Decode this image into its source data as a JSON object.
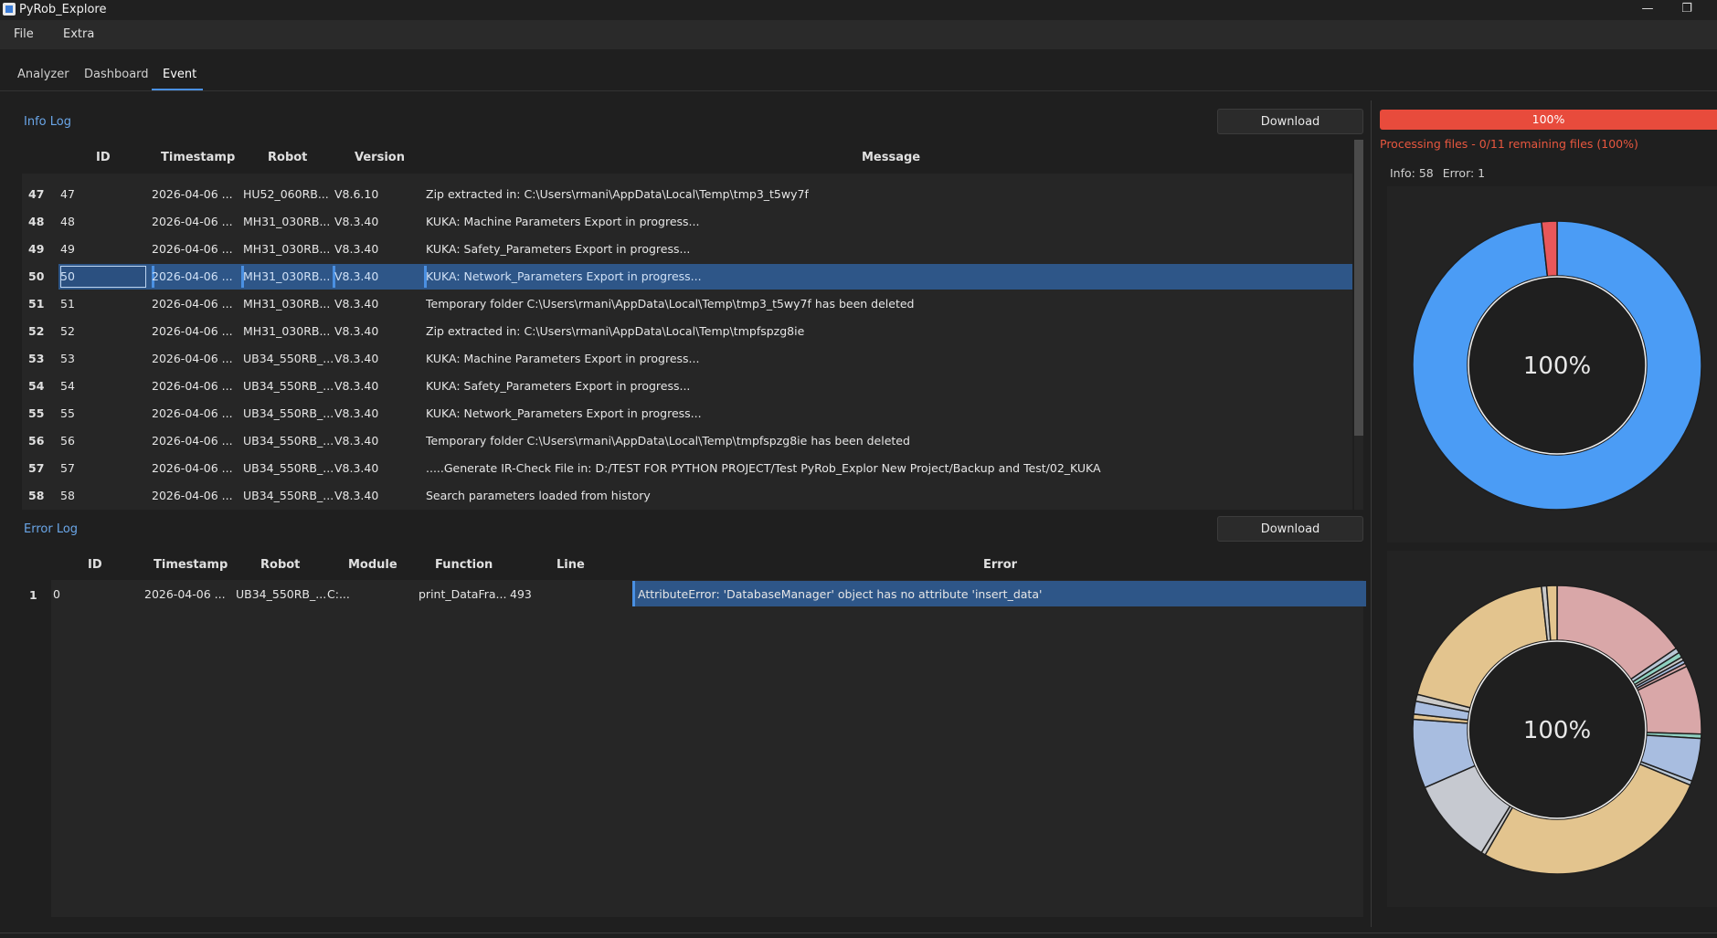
{
  "window": {
    "title": "PyRob_Explore",
    "minimize": "—",
    "restore": "❐"
  },
  "menu": {
    "items": [
      "File",
      "Extra"
    ]
  },
  "tabs": [
    "Analyzer",
    "Dashboard",
    "Event"
  ],
  "info_log": {
    "label": "Info Log",
    "download": "Download",
    "headers": {
      "id": "ID",
      "timestamp": "Timestamp",
      "robot": "Robot",
      "version": "Version",
      "message": "Message"
    },
    "rows": [
      {
        "n": "47",
        "id": "47",
        "ts": "2026-04-06 ...",
        "robot": "HU52_060RB...",
        "ver": "V8.6.10",
        "msg": "Zip extracted in: C:\\Users\\rmani\\AppData\\Local\\Temp\\tmp3_t5wy7f"
      },
      {
        "n": "48",
        "id": "48",
        "ts": "2026-04-06 ...",
        "robot": "MH31_030RB...",
        "ver": "V8.3.40",
        "msg": "KUKA: Machine Parameters Export in progress..."
      },
      {
        "n": "49",
        "id": "49",
        "ts": "2026-04-06 ...",
        "robot": "MH31_030RB...",
        "ver": "V8.3.40",
        "msg": "KUKA: Safety_Parameters Export in progress..."
      },
      {
        "n": "50",
        "id": "50",
        "ts": "2026-04-06 ...",
        "robot": "MH31_030RB...",
        "ver": "V8.3.40",
        "msg": "KUKA: Network_Parameters Export in progress..."
      },
      {
        "n": "51",
        "id": "51",
        "ts": "2026-04-06 ...",
        "robot": "MH31_030RB...",
        "ver": "V8.3.40",
        "msg": "Temporary folder C:\\Users\\rmani\\AppData\\Local\\Temp\\tmp3_t5wy7f has been deleted"
      },
      {
        "n": "52",
        "id": "52",
        "ts": "2026-04-06 ...",
        "robot": "MH31_030RB...",
        "ver": "V8.3.40",
        "msg": "Zip extracted in: C:\\Users\\rmani\\AppData\\Local\\Temp\\tmpfspzg8ie"
      },
      {
        "n": "53",
        "id": "53",
        "ts": "2026-04-06 ...",
        "robot": "UB34_550RB_...",
        "ver": "V8.3.40",
        "msg": "KUKA: Machine Parameters Export in progress..."
      },
      {
        "n": "54",
        "id": "54",
        "ts": "2026-04-06 ...",
        "robot": "UB34_550RB_...",
        "ver": "V8.3.40",
        "msg": "KUKA: Safety_Parameters Export in progress..."
      },
      {
        "n": "55",
        "id": "55",
        "ts": "2026-04-06 ...",
        "robot": "UB34_550RB_...",
        "ver": "V8.3.40",
        "msg": "KUKA: Network_Parameters Export in progress..."
      },
      {
        "n": "56",
        "id": "56",
        "ts": "2026-04-06 ...",
        "robot": "UB34_550RB_...",
        "ver": "V8.3.40",
        "msg": "Temporary folder C:\\Users\\rmani\\AppData\\Local\\Temp\\tmpfspzg8ie has been deleted"
      },
      {
        "n": "57",
        "id": "57",
        "ts": "2026-04-06 ...",
        "robot": "UB34_550RB_...",
        "ver": "V8.3.40",
        "msg": ".....Generate IR-Check File in: D:/TEST FOR PYTHON PROJECT/Test PyRob_Explor New Project/Backup  and Test/02_KUKA"
      },
      {
        "n": "58",
        "id": "58",
        "ts": "2026-04-06 ...",
        "robot": "UB34_550RB_...",
        "ver": "V8.3.40",
        "msg": "Search parameters loaded from history"
      }
    ]
  },
  "error_log": {
    "label": "Error Log",
    "download": "Download",
    "headers": {
      "id": "ID",
      "timestamp": "Timestamp",
      "robot": "Robot",
      "module": "Module",
      "function": "Function",
      "line": "Line",
      "error": "Error"
    },
    "rows": [
      {
        "n": "1",
        "id": "0",
        "ts": "2026-04-06 ...",
        "robot": "UB34_550RB_...",
        "module": "C:...",
        "function": "print_DataFra...",
        "line": "493",
        "error": "AttributeError: 'DatabaseManager' object has no attribute 'insert_data'"
      }
    ]
  },
  "status": {
    "progress_percent": 100,
    "progress_label": "100%",
    "processing_text": "Processing files - 0/11 remaining files (100%)",
    "info_label": "Info: 58",
    "error_label": "Error: 1",
    "color_error": "#e84b3c"
  },
  "charts": [
    {
      "center_label": "100%",
      "slices": [
        {
          "value": 57,
          "color": "#4b9cf5"
        },
        {
          "value": 1,
          "color": "#e8575a"
        }
      ]
    },
    {
      "center_label": "100%",
      "slices": [
        {
          "value": 16,
          "color": "#d9a7a8"
        },
        {
          "value": 0.6,
          "color": "#b9c7d6"
        },
        {
          "value": 0.6,
          "color": "#8fd0c0"
        },
        {
          "value": 0.4,
          "color": "#c9c9c9"
        },
        {
          "value": 0.4,
          "color": "#a8bde0"
        },
        {
          "value": 0.4,
          "color": "#d9a7a8"
        },
        {
          "value": 8,
          "color": "#d9a7a8"
        },
        {
          "value": 0.5,
          "color": "#8fd0c0"
        },
        {
          "value": 5,
          "color": "#a8bde0"
        },
        {
          "value": 0.5,
          "color": "#b9c7d6"
        },
        {
          "value": 28,
          "color": "#e3c48e"
        },
        {
          "value": 0.5,
          "color": "#c9c9c9"
        },
        {
          "value": 10,
          "color": "#c6c9d0"
        },
        {
          "value": 8,
          "color": "#a8bde0"
        },
        {
          "value": 0.6,
          "color": "#e3c48e"
        },
        {
          "value": 1.5,
          "color": "#a8bde0"
        },
        {
          "value": 0.8,
          "color": "#c9c9c9"
        },
        {
          "value": 20,
          "color": "#e3c48e"
        },
        {
          "value": 0.6,
          "color": "#c9c9c9"
        },
        {
          "value": 1.2,
          "color": "#e3c48e"
        }
      ]
    }
  ]
}
